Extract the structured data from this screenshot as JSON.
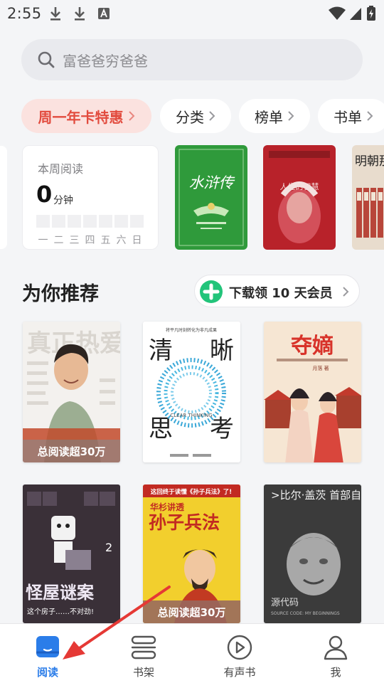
{
  "status_bar": {
    "time": "2:55",
    "left_icons": [
      "download-icon",
      "download-icon",
      "text-a-icon"
    ],
    "right_icons": [
      "wifi-icon",
      "signal-icon",
      "battery-charging-icon"
    ]
  },
  "search": {
    "icon": "search-icon",
    "placeholder": "富爸爸穷爸爸"
  },
  "chips": [
    {
      "label": "周一年卡特惠",
      "highlight": true
    },
    {
      "label": "分类",
      "highlight": false
    },
    {
      "label": "榜单",
      "highlight": false
    },
    {
      "label": "书单",
      "highlight": false
    }
  ],
  "reading_stats": {
    "title": "本周阅读",
    "minutes": "0",
    "unit": "分钟",
    "days": [
      "一",
      "二",
      "三",
      "四",
      "五",
      "六",
      "日"
    ]
  },
  "shelf_covers": [
    {
      "title": "水浒传",
      "color": "#2f9a3b"
    },
    {
      "title": "人生的智慧",
      "color": "#b8222a"
    },
    {
      "title": "明朝那些事儿",
      "color": "#e8dccd"
    }
  ],
  "recommend": {
    "title": "为你推荐",
    "vip_promo": "下载领 10 天会员",
    "vip_icon": "plus-circle-icon"
  },
  "books": [
    {
      "cover_text": "真正热爱",
      "badge": "总阅读超30万"
    },
    {
      "cover_text": "清晰思考",
      "cover_chars": [
        "清",
        "晰",
        "思",
        "考"
      ],
      "subtitle": "将平凡时刻转化为非凡成果",
      "cover_english": "CLEAR THINKING",
      "badge": ""
    },
    {
      "cover_text": "夺嫡",
      "author": "月落 著",
      "badge": ""
    },
    {
      "cover_text": "怪屋谜案",
      "subtitle": "这个房子……不对劲!",
      "badge": ""
    },
    {
      "cover_text": "孙子兵法",
      "subtitle": "华杉讲透",
      "banner": "这回终于读懂《孙子兵法》了!",
      "badge": "总阅读超30万"
    },
    {
      "cover_text": ">比尔·盖茨 首部自传",
      "subtitle": "源代码",
      "cover_english": "SOURCE CODE: MY BEGINNINGS",
      "badge": ""
    }
  ],
  "bottom_nav": [
    {
      "label": "阅读",
      "icon": "book-open-icon",
      "active": true
    },
    {
      "label": "书架",
      "icon": "bookshelf-icon",
      "active": false
    },
    {
      "label": "有声书",
      "icon": "play-circle-icon",
      "active": false
    },
    {
      "label": "我",
      "icon": "user-icon",
      "active": false
    }
  ],
  "colors": {
    "accent": "#2b7de9",
    "promo": "#e24b3e",
    "annotation_arrow": "#e53935"
  }
}
